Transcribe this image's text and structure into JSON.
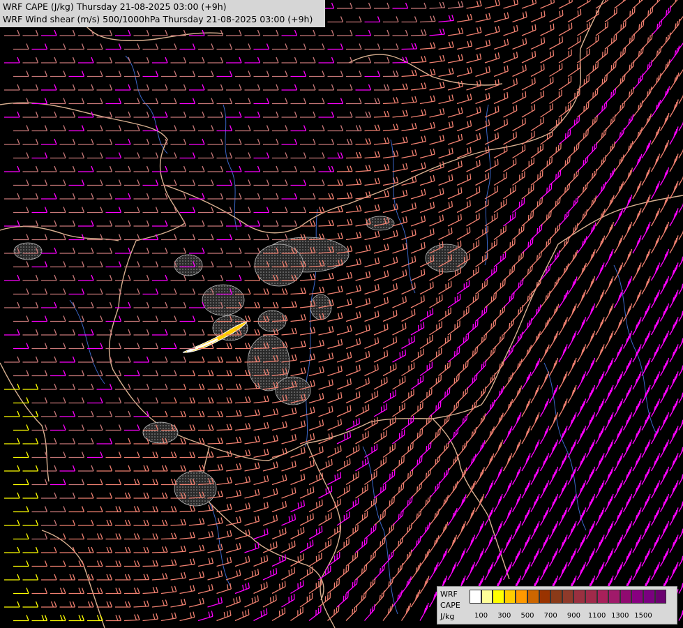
{
  "titles": {
    "line1": "WRF CAPE (J/kg) Thursday 21-08-2025 03:00 (+9h)",
    "line2": "WRF Wind shear (m/s) 500/1000hPa Thursday 21-08-2025 03:00 (+9h)"
  },
  "legend": {
    "label_1": "WRF",
    "label_2": "CAPE",
    "label_3": "J/kg",
    "swatch_colors": [
      "#ffffff",
      "#ffff99",
      "#ffff00",
      "#ffcc00",
      "#ff9900",
      "#cc6600",
      "#993300",
      "#8a3a18",
      "#8f3a2a",
      "#9a3040",
      "#a02a4a",
      "#a8205a",
      "#a01a6a",
      "#900a70",
      "#880080",
      "#7a0080",
      "#6b0070"
    ],
    "tick_labels": [
      "100",
      "300",
      "500",
      "700",
      "900",
      "1100",
      "1300",
      "1500"
    ]
  },
  "colors": {
    "background": "#000000",
    "barb_low": "#c87878",
    "barb_mid": "#f08070",
    "barb_high": "#ff00ff",
    "barb_extreme": "#ffff00",
    "border": "#d8b090",
    "river": "#3a66c8"
  }
}
